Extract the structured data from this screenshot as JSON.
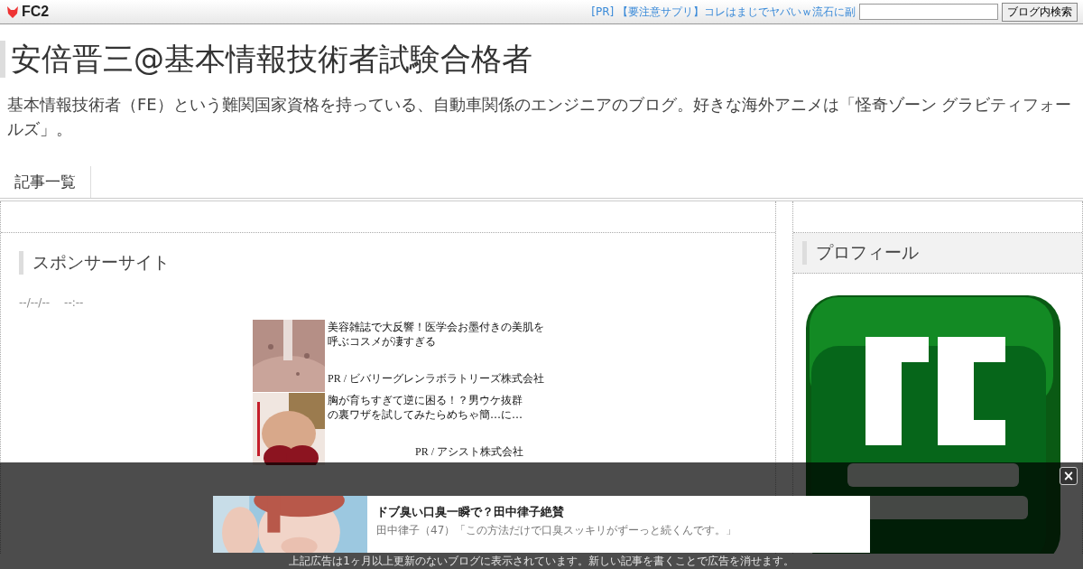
{
  "topbar": {
    "logo": "FC2",
    "pr_link": "[PR] 【要注意サプリ】コレはまじでヤバいｗ流石に副",
    "search_button": "ブログ内検索"
  },
  "blog": {
    "title": "安倍晋三@基本情報技術者試験合格者",
    "description": "基本情報技術者（FE）という難関国家資格を持っている、自動車関係のエンジニアのブログ。好きな海外アニメは「怪奇ゾーン グラビティフォールズ」。"
  },
  "tabs": [
    {
      "label": "記事一覧"
    }
  ],
  "main": {
    "heading": "スポンサーサイト",
    "date": "--/--/--",
    "time": "--:--",
    "ads": [
      {
        "title": "美容雑誌で大反響！医学会お墨付きの美肌を呼ぶコスメが凄すぎる",
        "sponsor": "PR / ビバリーグレンラボラトリーズ株式会社"
      },
      {
        "title": "胸が育ちすぎて逆に困る！？男ウケ抜群の裏ワザを試してみたらめちゃ簡…に…",
        "sponsor": "PR / アシスト株式会社"
      }
    ]
  },
  "sidebar": {
    "heading": "プロフィール"
  },
  "overlay_ad": {
    "close": "×",
    "title": "ドブ臭い口臭一瞬で？田中律子絶賛",
    "subtitle": "田中律子（47）「この方法だけで口臭スッキリがずーっと続くんです。」",
    "notice": "上記広告は1ヶ月以上更新のないブログに表示されています。新しい記事を書くことで広告を消せます。"
  }
}
